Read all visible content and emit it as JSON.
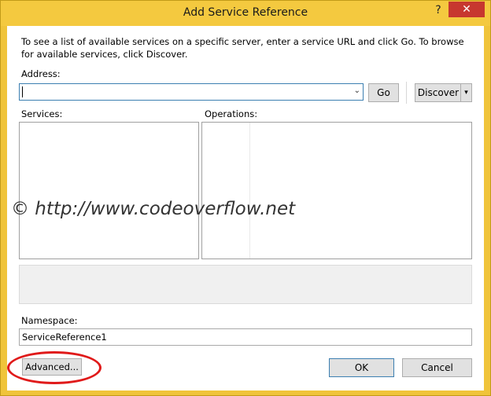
{
  "window": {
    "title": "Add Service Reference",
    "help_glyph": "?",
    "close_glyph": "✕"
  },
  "instructions": "To see a list of available services on a specific server, enter a service URL and click Go. To browse for available services, click Discover.",
  "address": {
    "label": "Address:",
    "value": "",
    "dropdown_glyph": "⌄"
  },
  "buttons": {
    "go": "Go",
    "discover": "Discover",
    "discover_split_glyph": "▾",
    "advanced": "Advanced...",
    "ok": "OK",
    "cancel": "Cancel"
  },
  "services": {
    "label": "Services:"
  },
  "operations": {
    "label": "Operations:"
  },
  "watermark": "©  http://www.codeoverflow.net",
  "namespace": {
    "label": "Namespace:",
    "value": "ServiceReference1"
  },
  "colors": {
    "titlebar": "#f4c93f",
    "close": "#c7372f",
    "annotation": "#e01a1a",
    "focus_border": "#3c7fb1"
  }
}
